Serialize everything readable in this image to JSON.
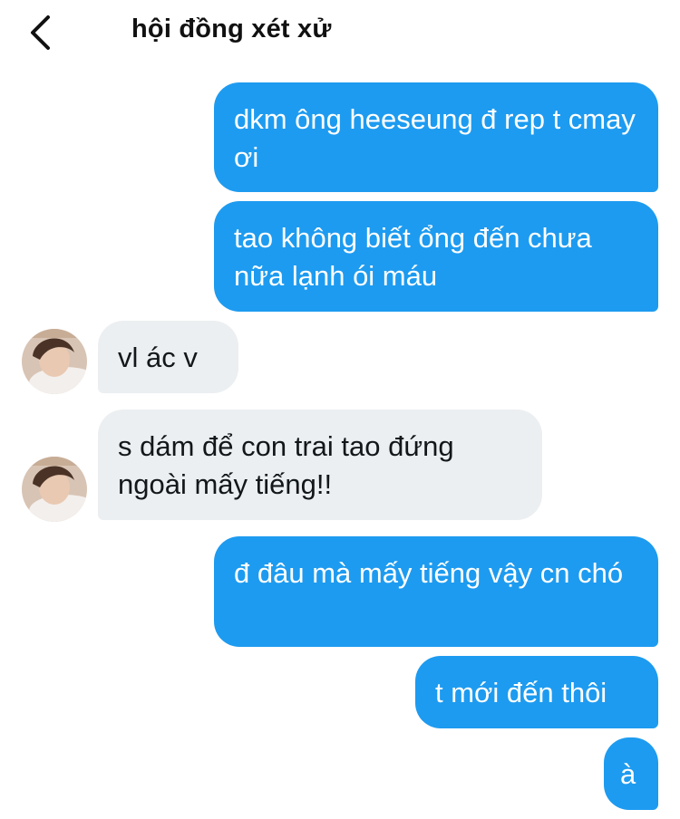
{
  "header": {
    "back_icon": "chevron-left-icon",
    "title": "hội đồng xét xử"
  },
  "colors": {
    "outgoing_bubble": "#1d9bf0",
    "incoming_bubble": "#eceff1",
    "outgoing_text": "#ffffff",
    "incoming_text": "#14171a"
  },
  "messages": [
    {
      "direction": "outgoing",
      "text": "dkm ông heeseung đ rep t cmay ơi"
    },
    {
      "direction": "outgoing",
      "text": "tao không biết ổng đến chưa nữa lạnh ói máu"
    },
    {
      "direction": "incoming",
      "text": "vl ác v"
    },
    {
      "direction": "incoming",
      "text": "s dám để con trai tao đứng ngoài mấy tiếng!!"
    },
    {
      "direction": "outgoing",
      "text": "đ đâu mà mấy tiếng vậy cn chó"
    },
    {
      "direction": "outgoing",
      "text": "t mới đến thôi"
    },
    {
      "direction": "outgoing",
      "text": "à"
    }
  ]
}
